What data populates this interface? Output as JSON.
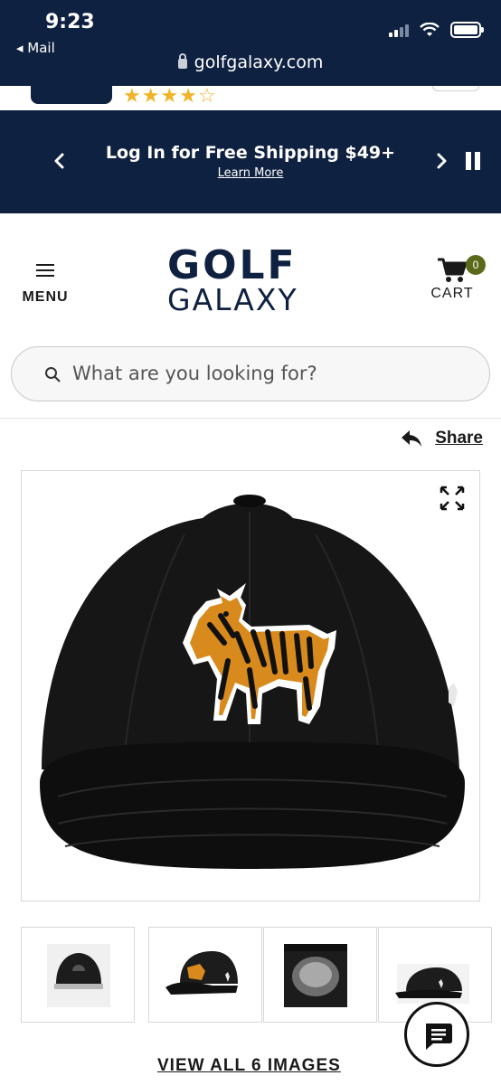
{
  "status_bar": {
    "time": "9:23",
    "back_app": "◂ Mail",
    "url": "golfgalaxy.com"
  },
  "promo": {
    "title": "Log In for Free Shipping $49+",
    "link": "Learn More"
  },
  "header": {
    "menu_label": "MENU",
    "logo_top": "GOLF",
    "logo_bottom": "GALAXY",
    "cart_label": "CART",
    "cart_count": "0"
  },
  "search": {
    "placeholder": "What are you looking for?"
  },
  "share": {
    "label": "Share"
  },
  "gallery": {
    "view_all": "VIEW ALL 6 IMAGES",
    "thumbnails": [
      "cap-back-view",
      "cap-side-view",
      "cap-underside-view",
      "cap-profile-view"
    ]
  },
  "partial_rating": {
    "stars": 4,
    "max": 5
  },
  "colors": {
    "navy": "#0f2140",
    "badge": "#5a6a1a",
    "star": "#f0b429"
  }
}
